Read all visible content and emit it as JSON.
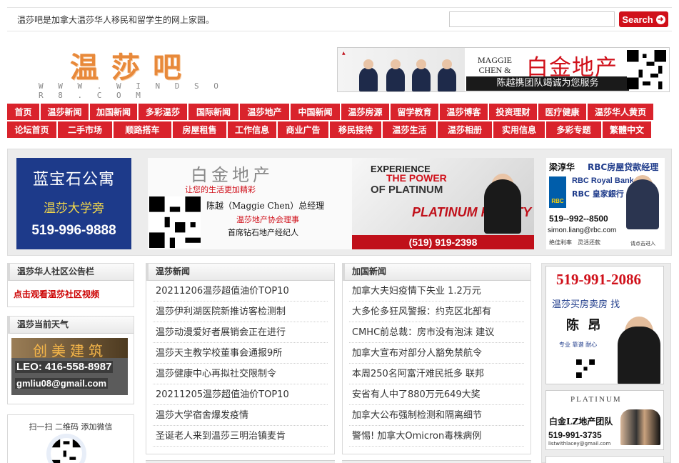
{
  "topbar": {
    "slogan": "温莎吧是加拿大温莎华人移民和留学生的网上家园。",
    "search_placeholder": "",
    "search_label": "Search"
  },
  "logo": {
    "text": "温莎吧",
    "url": "W W W . W I N D S O R 8 . C O M"
  },
  "header_ad": {
    "team": "MAGGIE CHEN & TEAM",
    "title": "白金地产",
    "slogan": "陈越携团队竭诚为您服务"
  },
  "nav": {
    "row1": [
      "首页",
      "温莎新闻",
      "加国新闻",
      "多彩温莎",
      "国际新闻",
      "温莎地产",
      "中国新闻",
      "温莎房源",
      "留学教育",
      "温莎博客",
      "投资理财",
      "医疗健康",
      "温莎华人黄页"
    ],
    "row2": [
      "论坛首页",
      "二手市场",
      "顺路搭车",
      "房屋租售",
      "工作信息",
      "商业广告",
      "移民接待",
      "温莎生活",
      "温莎相册",
      "实用信息",
      "多彩专题",
      "繁體中文"
    ]
  },
  "ads": {
    "sapphire": {
      "line1": "蓝宝石公寓",
      "line2": "温莎大学旁",
      "phone": "519-996-9888"
    },
    "platinum": {
      "title": "白金地产",
      "tagline": "让您的生活更加精彩",
      "name": "陈越（Maggie Chen）总经理",
      "role1": "温莎地产协会理事",
      "role2": "首席钻石地产经纪人",
      "experience": "EXPERIENCE",
      "power": "THE POWER",
      "of_platinum": "OF PLATINUM",
      "realty": "PLATINUM REALTY",
      "phone": "(519) 919-2398"
    },
    "rbc": {
      "name": "梁淳华",
      "role": "RBC房屋贷款经理",
      "bank_en": "RBC Royal Bank",
      "bank_cn": "RBC 皇家銀行",
      "phone": "519--992--8500",
      "email": "simon.liang@rbc.com",
      "footer": "绝佳利率　灵活还款",
      "footer2": "请点击进入"
    },
    "side1": {
      "phone": "519-991-2086",
      "line1": "温莎买房卖房 找",
      "name": "陈 昂",
      "line2": "专业 靠谱 耐心"
    },
    "side2": {
      "brand": "PLATINUM",
      "line1": "白金LZ地产团队",
      "phone": "519-991-3735",
      "email": "listwithlacey@gmail.com"
    }
  },
  "left": {
    "notice_title": "温莎华人社区公告栏",
    "notice_link": "点击观看温莎社区视频",
    "weather_title": "温莎当前天气",
    "weather_ad": {
      "brand": "创美建筑",
      "leo": "LEO: 416-558-8987",
      "email": "gmliu08@gmail.com"
    },
    "wechat": "扫一扫 二维码 添加微信"
  },
  "windsor_news": {
    "title": "温莎新闻",
    "items": [
      "20211206温莎超值油价TOP10",
      "温莎伊利湖医院新推访客检测制",
      "温莎动漫爱好者展销会正在进行",
      "温莎天主教学校董事会通报9所",
      "温莎健康中心再拟社交限制令",
      "20211205温莎超值油价TOP10",
      "温莎大学宿舍爆发疫情",
      "圣诞老人来到温莎三明治镇麦肯"
    ]
  },
  "canada_news": {
    "title": "加国新闻",
    "items": [
      "加拿大夫妇疫情下失业 1.2万元",
      "大多伦多狂风警报：约克区北部有",
      "CMHC前总裁：房市没有泡沫 建议",
      "加拿大宣布对部分人豁免禁航令",
      "本周250名阿富汗难民抵多 联邦",
      "安省有人中了880万元649大奖",
      "加拿大公布强制检测和隔离细节",
      "警惕! 加拿大Omicron毒株病例"
    ]
  },
  "colors": {
    "brand_red": "#d9232c",
    "accent_orange": "#e8893a",
    "rbc_blue": "#005daa"
  }
}
